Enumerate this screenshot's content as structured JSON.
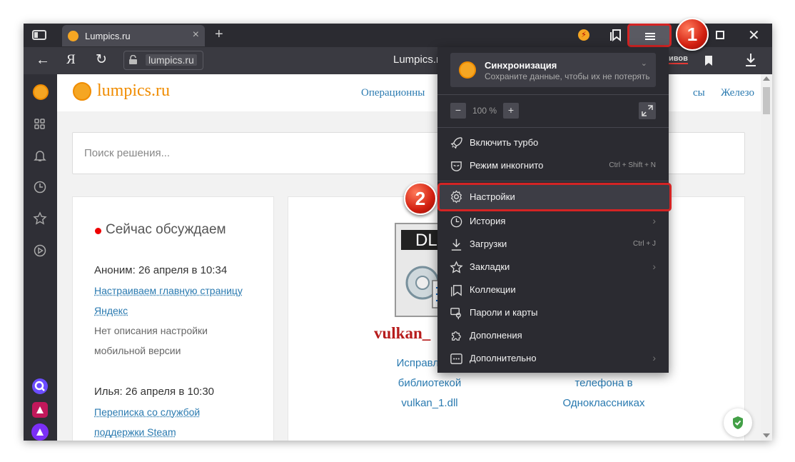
{
  "browser": {
    "tab": {
      "title": "Lumpics.ru",
      "close": "×"
    },
    "new_tab": "+",
    "address": {
      "back": "←",
      "yandex": "Я",
      "reload": "↻",
      "url": "lumpics.ru",
      "page_title": "Lumpics.ru",
      "bookmark_fragment": "ивов"
    },
    "window": {
      "close": "✕"
    }
  },
  "page": {
    "logo_text": "lumpics.ru",
    "nav": [
      {
        "label": "Операционны"
      },
      {
        "label": "сы"
      },
      {
        "label": "Железо"
      }
    ],
    "search_placeholder": "Поиск решения...",
    "discussion": {
      "title": "Сейчас обсуждаем",
      "items": [
        {
          "author": "Аноним: 26 апреля в 10:34",
          "link_lines": [
            "Настраиваем главную страницу",
            "Яндекс"
          ],
          "desc_lines": [
            "Нет описания настройки",
            "мобильной версии"
          ]
        },
        {
          "author": "Илья: 26 апреля в 10:30",
          "link_lines": [
            "Переписка со службой",
            "поддержки Steam"
          ]
        }
      ]
    },
    "article1": {
      "image_text": "DLL",
      "image_caption": "vulkan_",
      "lines": [
        "Исправление",
        "библиотекой",
        "vulkan_1.dll"
      ]
    },
    "article2": {
      "lines": [
        "телефона в",
        "Одноклассниках"
      ]
    }
  },
  "menu": {
    "sync": {
      "title": "Синхронизация",
      "subtitle": "Сохраните данные, чтобы их не потерять",
      "chevron": "⌄"
    },
    "zoom": {
      "minus": "−",
      "value": "100 %",
      "plus": "+"
    },
    "items": [
      {
        "label": "Включить турбо",
        "icon": "rocket-icon"
      },
      {
        "label": "Режим инкогнито",
        "hotkey": "Ctrl + Shift + N",
        "icon": "incognito-mask-icon"
      },
      {
        "label": "Настройки",
        "icon": "gear-icon"
      },
      {
        "label": "История",
        "icon": "clock-icon",
        "arrow": "›"
      },
      {
        "label": "Загрузки",
        "hotkey": "Ctrl + J",
        "icon": "download-icon"
      },
      {
        "label": "Закладки",
        "icon": "star-icon",
        "arrow": "›"
      },
      {
        "label": "Коллекции",
        "icon": "collections-icon"
      },
      {
        "label": "Пароли и карты",
        "icon": "key-card-icon"
      },
      {
        "label": "Дополнения",
        "icon": "puzzle-icon"
      },
      {
        "label": "Дополнительно",
        "icon": "more-icon",
        "arrow": "›"
      }
    ]
  },
  "steps": {
    "one": "1",
    "two": "2"
  },
  "colors": {
    "accent_red": "#d42424",
    "link_blue": "#2a7ab0",
    "menu_bg": "#2b2b31",
    "brand_orange": "#f08c00"
  }
}
